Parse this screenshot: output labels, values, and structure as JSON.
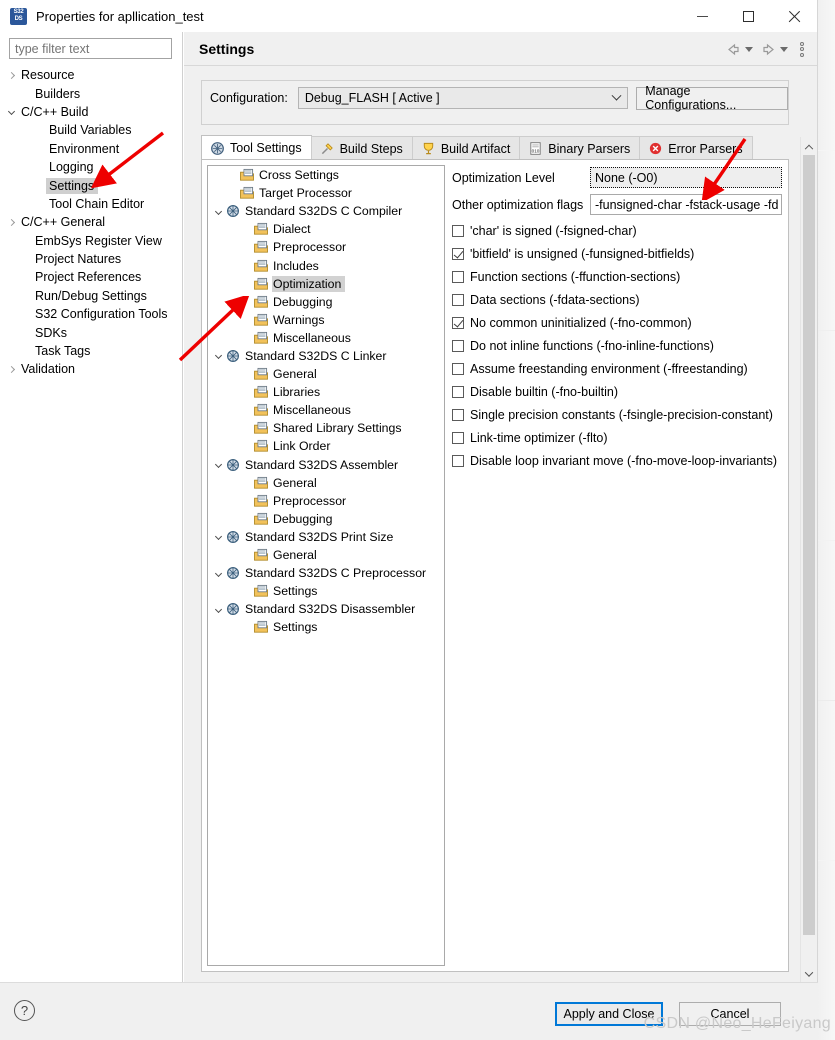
{
  "window": {
    "title": "Properties for apllication_test",
    "icon": "s32ds-icon",
    "minimize_label": "–",
    "maximize_label": "□",
    "close_label": "✕"
  },
  "sidebar": {
    "filter": {
      "placeholder": "type filter text",
      "value": ""
    },
    "items": [
      {
        "label": "Resource",
        "indent": 0,
        "expander": "right",
        "selected": false
      },
      {
        "label": "Builders",
        "indent": 1,
        "expander": "none",
        "selected": false
      },
      {
        "label": "C/C++ Build",
        "indent": 0,
        "expander": "down",
        "selected": false
      },
      {
        "label": "Build Variables",
        "indent": 2,
        "expander": "none",
        "selected": false
      },
      {
        "label": "Environment",
        "indent": 2,
        "expander": "none",
        "selected": false
      },
      {
        "label": "Logging",
        "indent": 2,
        "expander": "none",
        "selected": false
      },
      {
        "label": "Settings",
        "indent": 2,
        "expander": "none",
        "selected": true
      },
      {
        "label": "Tool Chain Editor",
        "indent": 2,
        "expander": "none",
        "selected": false
      },
      {
        "label": "C/C++ General",
        "indent": 0,
        "expander": "right",
        "selected": false
      },
      {
        "label": "EmbSys Register View",
        "indent": 1,
        "expander": "none",
        "selected": false
      },
      {
        "label": "Project Natures",
        "indent": 1,
        "expander": "none",
        "selected": false
      },
      {
        "label": "Project References",
        "indent": 1,
        "expander": "none",
        "selected": false
      },
      {
        "label": "Run/Debug Settings",
        "indent": 1,
        "expander": "none",
        "selected": false
      },
      {
        "label": "S32 Configuration Tools",
        "indent": 1,
        "expander": "none",
        "selected": false
      },
      {
        "label": "SDKs",
        "indent": 1,
        "expander": "none",
        "selected": false
      },
      {
        "label": "Task Tags",
        "indent": 1,
        "expander": "none",
        "selected": false
      },
      {
        "label": "Validation",
        "indent": 0,
        "expander": "right",
        "selected": false
      }
    ]
  },
  "header": {
    "title": "Settings",
    "back_icon": "back-arrow-icon",
    "back_caret_icon": "chevron-down-icon",
    "forward_icon": "forward-arrow-icon",
    "forward_caret_icon": "chevron-down-icon",
    "menu_icon": "view-menu-icon"
  },
  "configuration": {
    "label": "Configuration:",
    "value": "Debug_FLASH  [ Active ]",
    "dropdown_icon": "chevron-down-icon",
    "manage_label": "Manage Configurations..."
  },
  "tabs": [
    {
      "label": "Tool Settings",
      "icon": "tool-settings-icon",
      "active": true
    },
    {
      "label": "Build Steps",
      "icon": "build-steps-icon",
      "active": false
    },
    {
      "label": "Build Artifact",
      "icon": "build-artifact-icon",
      "active": false
    },
    {
      "label": "Binary Parsers",
      "icon": "binary-parsers-icon",
      "active": false
    },
    {
      "label": "Error Parsers",
      "icon": "error-parsers-icon",
      "active": false
    }
  ],
  "tool_tree": [
    {
      "label": "Cross Settings",
      "indent": 1,
      "expander": "none",
      "icon": "page-icon",
      "selected": false
    },
    {
      "label": "Target Processor",
      "indent": 1,
      "expander": "none",
      "icon": "page-icon",
      "selected": false
    },
    {
      "label": "Standard S32DS C Compiler",
      "indent": 0,
      "expander": "down",
      "icon": "tool-icon",
      "selected": false
    },
    {
      "label": "Dialect",
      "indent": 2,
      "expander": "none",
      "icon": "page-icon",
      "selected": false
    },
    {
      "label": "Preprocessor",
      "indent": 2,
      "expander": "none",
      "icon": "page-icon",
      "selected": false
    },
    {
      "label": "Includes",
      "indent": 2,
      "expander": "none",
      "icon": "page-icon",
      "selected": false
    },
    {
      "label": "Optimization",
      "indent": 2,
      "expander": "none",
      "icon": "page-icon",
      "selected": true
    },
    {
      "label": "Debugging",
      "indent": 2,
      "expander": "none",
      "icon": "page-icon",
      "selected": false
    },
    {
      "label": "Warnings",
      "indent": 2,
      "expander": "none",
      "icon": "page-icon",
      "selected": false
    },
    {
      "label": "Miscellaneous",
      "indent": 2,
      "expander": "none",
      "icon": "page-icon",
      "selected": false
    },
    {
      "label": "Standard S32DS C Linker",
      "indent": 0,
      "expander": "down",
      "icon": "tool-icon",
      "selected": false
    },
    {
      "label": "General",
      "indent": 2,
      "expander": "none",
      "icon": "page-icon",
      "selected": false
    },
    {
      "label": "Libraries",
      "indent": 2,
      "expander": "none",
      "icon": "page-icon",
      "selected": false
    },
    {
      "label": "Miscellaneous",
      "indent": 2,
      "expander": "none",
      "icon": "page-icon",
      "selected": false
    },
    {
      "label": "Shared Library Settings",
      "indent": 2,
      "expander": "none",
      "icon": "page-icon",
      "selected": false
    },
    {
      "label": "Link Order",
      "indent": 2,
      "expander": "none",
      "icon": "page-icon",
      "selected": false
    },
    {
      "label": "Standard S32DS Assembler",
      "indent": 0,
      "expander": "down",
      "icon": "tool-icon",
      "selected": false
    },
    {
      "label": "General",
      "indent": 2,
      "expander": "none",
      "icon": "page-icon",
      "selected": false
    },
    {
      "label": "Preprocessor",
      "indent": 2,
      "expander": "none",
      "icon": "page-icon",
      "selected": false
    },
    {
      "label": "Debugging",
      "indent": 2,
      "expander": "none",
      "icon": "page-icon",
      "selected": false
    },
    {
      "label": "Standard S32DS Print Size",
      "indent": 0,
      "expander": "down",
      "icon": "tool-icon",
      "selected": false
    },
    {
      "label": "General",
      "indent": 2,
      "expander": "none",
      "icon": "page-icon",
      "selected": false
    },
    {
      "label": "Standard S32DS C Preprocessor",
      "indent": 0,
      "expander": "down",
      "icon": "tool-icon",
      "selected": false
    },
    {
      "label": "Settings",
      "indent": 2,
      "expander": "none",
      "icon": "page-icon",
      "selected": false
    },
    {
      "label": "Standard S32DS Disassembler",
      "indent": 0,
      "expander": "down",
      "icon": "tool-icon",
      "selected": false
    },
    {
      "label": "Settings",
      "indent": 2,
      "expander": "none",
      "icon": "page-icon",
      "selected": false
    }
  ],
  "options": {
    "optimization_level": {
      "label": "Optimization Level",
      "value": "None (-O0)",
      "focused": true
    },
    "other_flags": {
      "label": "Other optimization flags",
      "value": "-funsigned-char -fstack-usage -fd"
    },
    "checkboxes": [
      {
        "label": "'char' is signed (-fsigned-char)",
        "checked": false
      },
      {
        "label": "'bitfield' is unsigned (-funsigned-bitfields)",
        "checked": true
      },
      {
        "label": "Function sections (-ffunction-sections)",
        "checked": false
      },
      {
        "label": "Data sections (-fdata-sections)",
        "checked": false
      },
      {
        "label": "No common uninitialized (-fno-common)",
        "checked": true
      },
      {
        "label": "Do not inline functions (-fno-inline-functions)",
        "checked": false
      },
      {
        "label": "Assume freestanding environment (-ffreestanding)",
        "checked": false
      },
      {
        "label": "Disable builtin (-fno-builtin)",
        "checked": false
      },
      {
        "label": "Single precision constants (-fsingle-precision-constant)",
        "checked": false
      },
      {
        "label": "Link-time optimizer (-flto)",
        "checked": false
      },
      {
        "label": "Disable loop invariant move (-fno-move-loop-invariants)",
        "checked": false
      }
    ]
  },
  "footer": {
    "help_label": "?",
    "apply_label": "Apply and Close",
    "cancel_label": "Cancel"
  },
  "watermark": "CSDN @Neo_HeFeiyang",
  "annotations": {
    "arrow_color": "#ee0000",
    "arrow_sidebar_settings": "points to Settings in left tree",
    "arrow_optimization": "points to Optimization in tool tree",
    "arrow_optimization_level": "points to Optimization Level field"
  },
  "colors": {
    "accent": "#0078d7",
    "selection": "#cfcfcf",
    "arrow": "#ee0000",
    "watermark": "#c9c9c9"
  }
}
